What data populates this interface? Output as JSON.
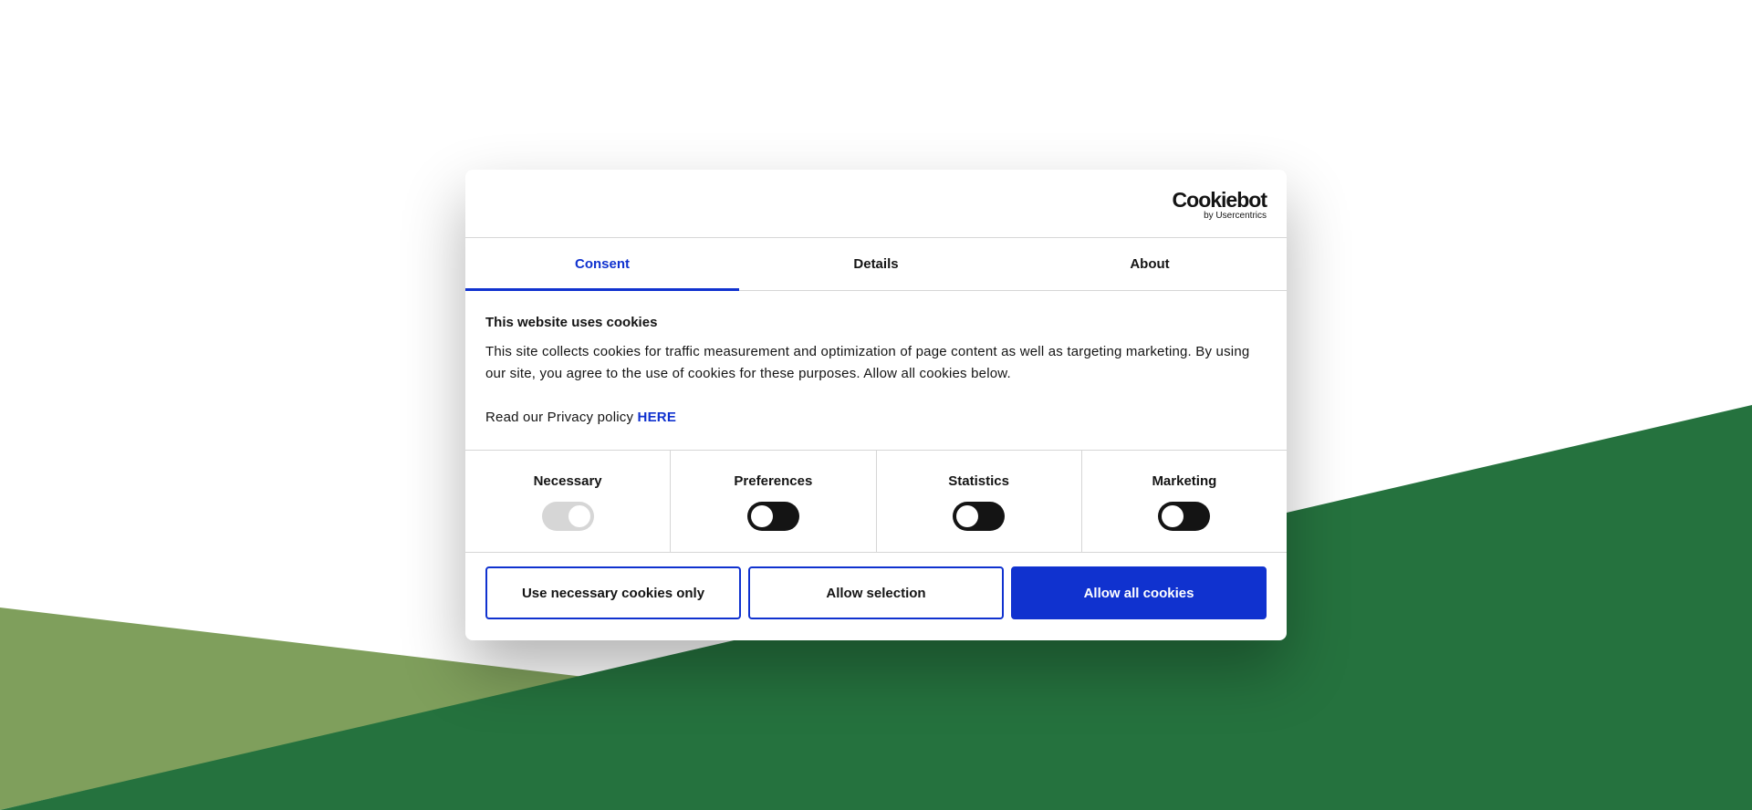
{
  "colors": {
    "accent": "#1032cf",
    "dark_green": "#25723e",
    "light_green": "#7f9f5c",
    "toggle_off": "#141414",
    "toggle_disabled": "#d6d6d6"
  },
  "logo": {
    "brand": "Cookiebot",
    "sub": "by Usercentrics"
  },
  "tabs": [
    {
      "label": "Consent",
      "active": true
    },
    {
      "label": "Details",
      "active": false
    },
    {
      "label": "About",
      "active": false
    }
  ],
  "consent": {
    "title": "This website uses cookies",
    "text": "This site collects cookies for traffic measurement and optimization of page content as well as targeting marketing. By using our site, you agree to the use of cookies for these purposes. Allow all cookies below.",
    "policy_text": "Read our Privacy policy",
    "policy_link": "HERE"
  },
  "categories": [
    {
      "label": "Necessary",
      "state": "on-disabled"
    },
    {
      "label": "Preferences",
      "state": "off"
    },
    {
      "label": "Statistics",
      "state": "off"
    },
    {
      "label": "Marketing",
      "state": "off"
    }
  ],
  "buttons": {
    "necessary_only": "Use necessary cookies only",
    "allow_selection": "Allow selection",
    "allow_all": "Allow all cookies"
  }
}
